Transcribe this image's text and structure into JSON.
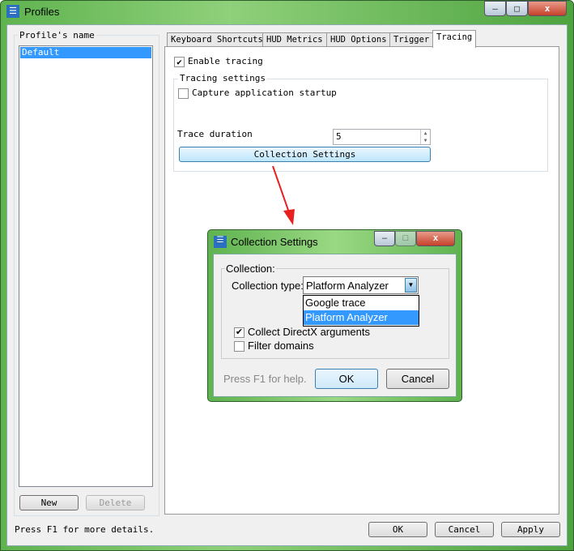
{
  "window": {
    "title": "Profiles",
    "icon": "settings-sliders-icon",
    "minimize": "–",
    "maximize": "□",
    "close": "x"
  },
  "profiles": {
    "group_label": "Profile's name",
    "items": [
      "Default"
    ],
    "selected": 0,
    "new_label": "New",
    "delete_label": "Delete"
  },
  "tabs": [
    {
      "label": "Keyboard Shortcuts"
    },
    {
      "label": "HUD Metrics"
    },
    {
      "label": "HUD Options"
    },
    {
      "label": "Trigger"
    },
    {
      "label": "Tracing",
      "active": true
    }
  ],
  "tracing": {
    "enable_label": "Enable tracing",
    "enable_checked": true,
    "settings_group": "Tracing settings",
    "capture_label": "Capture application startup",
    "capture_checked": false,
    "duration_label": "Trace duration",
    "duration_value": "5",
    "collection_button": "Collection Settings"
  },
  "footer": {
    "status": "Press F1 for more details.",
    "ok": "OK",
    "cancel": "Cancel",
    "apply": "Apply"
  },
  "dialog": {
    "title": "Collection Settings",
    "group_label": "Collection:",
    "type_label": "Collection type:",
    "type_value": "Platform Analyzer",
    "options": [
      "Google trace",
      "Platform Analyzer"
    ],
    "highlighted_option": 1,
    "directx_label": "Collect DirectX arguments",
    "directx_checked": true,
    "filter_label": "Filter domains",
    "filter_checked": false,
    "help": "Press F1 for help.",
    "ok": "OK",
    "cancel": "Cancel"
  },
  "colors": {
    "accent": "#3399ff",
    "annotation_arrow": "#e82020",
    "title_bar": "#5fb34f"
  }
}
